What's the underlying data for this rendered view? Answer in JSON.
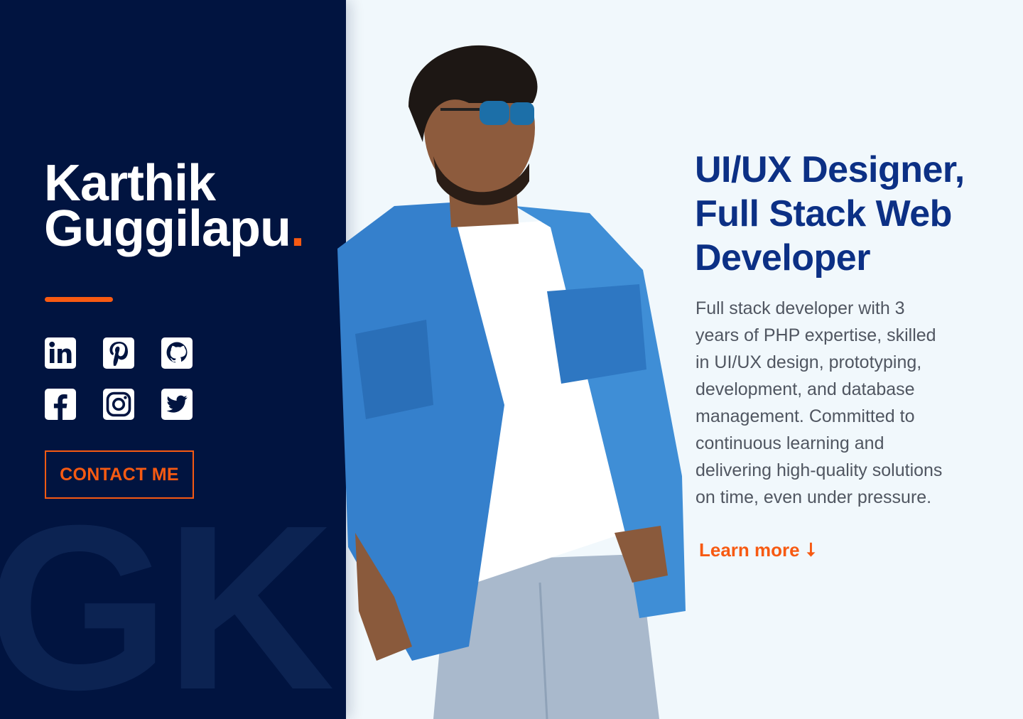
{
  "profile": {
    "first_name": "Karthik",
    "last_name": "Guggilapu",
    "name_dot": ".",
    "watermark": "GK."
  },
  "social": [
    {
      "name": "linkedin-icon"
    },
    {
      "name": "pinterest-icon"
    },
    {
      "name": "github-icon"
    },
    {
      "name": "facebook-icon"
    },
    {
      "name": "instagram-icon"
    },
    {
      "name": "twitter-icon"
    }
  ],
  "cta": {
    "contact_label": "CONTACT ME"
  },
  "hero": {
    "headline_lines": [
      "UI/UX Designer,",
      "Full Stack Web",
      "Developer"
    ],
    "bio_lines": [
      "Full stack developer with 3",
      "years of PHP expertise, skilled",
      "in UI/UX design, prototyping,",
      "development, and database",
      "management. Committed to",
      "continuous learning and",
      "delivering high-quality solutions",
      "on time, even under pressure."
    ],
    "learn_more_label": "Learn more",
    "learn_more_arrow": "⭣"
  },
  "colors": {
    "panel": "#011440",
    "accent": "#f75a12",
    "headline": "#0c3085",
    "background": "#f1f8fc"
  }
}
